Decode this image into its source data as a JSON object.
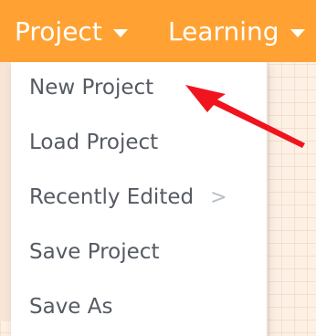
{
  "menubar": {
    "project_label": "Project",
    "learning_label": "Learning"
  },
  "project_menu": {
    "items": [
      {
        "label": "New Project"
      },
      {
        "label": "Load Project"
      },
      {
        "label": "Recently Edited",
        "submenu_indicator": ">"
      },
      {
        "label": "Save Project"
      },
      {
        "label": "Save As"
      }
    ]
  },
  "colors": {
    "menubar_bg": "#ffa233",
    "annotation_arrow": "#f0141e"
  },
  "annotation": {
    "type": "arrow",
    "points_to": "New Project"
  }
}
